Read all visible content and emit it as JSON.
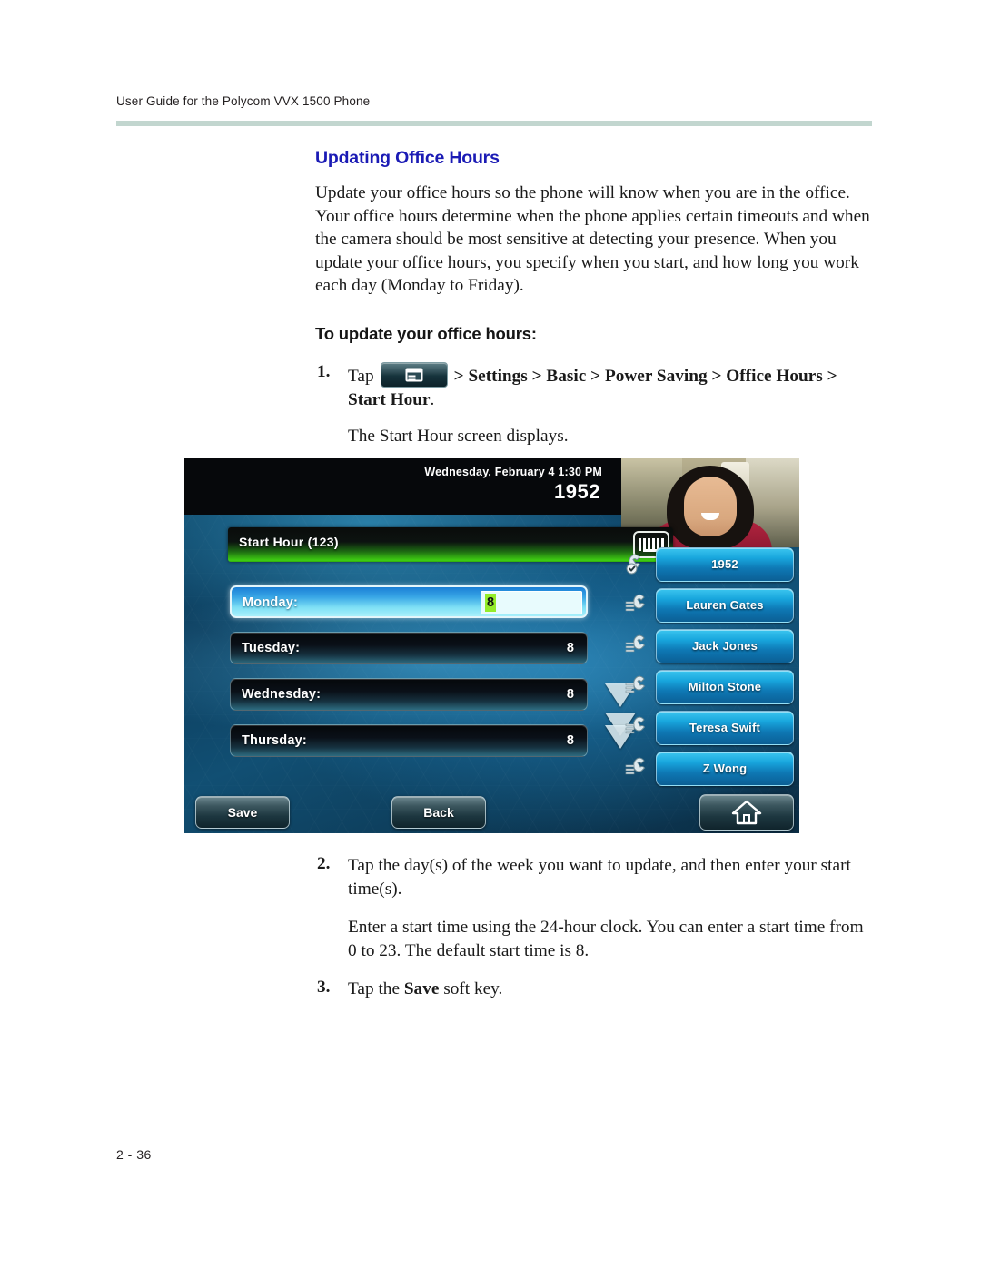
{
  "document": {
    "running_header": "User Guide for the Polycom VVX 1500 Phone",
    "folio": "2 - 36"
  },
  "section": {
    "title": "Updating Office Hours",
    "intro": "Update your office hours so the phone will know when you are in the office. Your office hours determine when the phone applies certain timeouts and when the camera should be most sensitive at detecting your presence. When you update your office hours, you specify when you start, and how long you work each day (Monday to Friday).",
    "procedure_title": "To update your office hours:"
  },
  "steps": [
    {
      "number": "1.",
      "lead": "Tap",
      "icon": "menu-key-icon",
      "path_bold": "> Settings > Basic > Power Saving > Office Hours > Start Hour",
      "path_tail": ".",
      "note": "The Start Hour screen displays."
    },
    {
      "number": "2.",
      "text": "Tap the day(s) of the week you want to update, and then enter your start time(s).",
      "note": "Enter a start time using the 24-hour clock. You can enter a start time from 0 to 23. The default start time is 8."
    },
    {
      "number": "3.",
      "text_prefix": "Tap the ",
      "text_bold": "Save",
      "text_suffix": " soft key."
    }
  ],
  "phone_screen": {
    "status": {
      "date_time": "Wednesday, February 4  1:30 PM",
      "extension": "1952"
    },
    "title_bar": {
      "label": "Start Hour (123)",
      "keyboard_icon": "keyboard-icon"
    },
    "rows": [
      {
        "label": "Monday:",
        "value": "8",
        "selected": true
      },
      {
        "label": "Tuesday:",
        "value": "8",
        "selected": false
      },
      {
        "label": "Wednesday:",
        "value": "8",
        "selected": false
      },
      {
        "label": "Thursday:",
        "value": "8",
        "selected": false
      }
    ],
    "line_keys": [
      {
        "label": "1952",
        "icon": "handset-registered-icon"
      },
      {
        "label": "Lauren Gates",
        "icon": "handset-icon"
      },
      {
        "label": "Jack Jones",
        "icon": "handset-icon"
      },
      {
        "label": "Milton Stone",
        "icon": "handset-icon"
      },
      {
        "label": "Teresa Swift",
        "icon": "handset-icon"
      },
      {
        "label": "Z Wong",
        "icon": "handset-icon"
      }
    ],
    "soft_keys": {
      "save": "Save",
      "back": "Back",
      "home_icon": "home-icon"
    },
    "scroll_indicator": "scroll-down-icon",
    "colors": {
      "title_bar_green": "#3fcf12",
      "selected_row": "#7fe0f5",
      "edit_highlight": "#93ec2a",
      "line_key_blue": "#18a6dd"
    }
  },
  "colors": {
    "heading_blue": "#1b1bb5",
    "header_rule": "#c2d6cf"
  }
}
